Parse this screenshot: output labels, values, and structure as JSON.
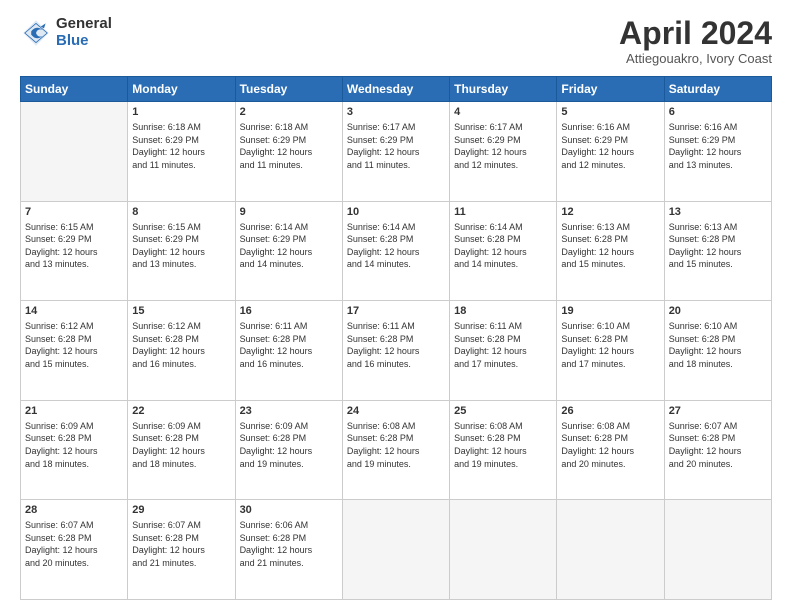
{
  "logo": {
    "general": "General",
    "blue": "Blue"
  },
  "header": {
    "month": "April 2024",
    "location": "Attiegouakro, Ivory Coast"
  },
  "weekdays": [
    "Sunday",
    "Monday",
    "Tuesday",
    "Wednesday",
    "Thursday",
    "Friday",
    "Saturday"
  ],
  "weeks": [
    [
      {
        "day": "",
        "info": ""
      },
      {
        "day": "1",
        "info": "Sunrise: 6:18 AM\nSunset: 6:29 PM\nDaylight: 12 hours\nand 11 minutes."
      },
      {
        "day": "2",
        "info": "Sunrise: 6:18 AM\nSunset: 6:29 PM\nDaylight: 12 hours\nand 11 minutes."
      },
      {
        "day": "3",
        "info": "Sunrise: 6:17 AM\nSunset: 6:29 PM\nDaylight: 12 hours\nand 11 minutes."
      },
      {
        "day": "4",
        "info": "Sunrise: 6:17 AM\nSunset: 6:29 PM\nDaylight: 12 hours\nand 12 minutes."
      },
      {
        "day": "5",
        "info": "Sunrise: 6:16 AM\nSunset: 6:29 PM\nDaylight: 12 hours\nand 12 minutes."
      },
      {
        "day": "6",
        "info": "Sunrise: 6:16 AM\nSunset: 6:29 PM\nDaylight: 12 hours\nand 13 minutes."
      }
    ],
    [
      {
        "day": "7",
        "info": "Sunrise: 6:15 AM\nSunset: 6:29 PM\nDaylight: 12 hours\nand 13 minutes."
      },
      {
        "day": "8",
        "info": "Sunrise: 6:15 AM\nSunset: 6:29 PM\nDaylight: 12 hours\nand 13 minutes."
      },
      {
        "day": "9",
        "info": "Sunrise: 6:14 AM\nSunset: 6:29 PM\nDaylight: 12 hours\nand 14 minutes."
      },
      {
        "day": "10",
        "info": "Sunrise: 6:14 AM\nSunset: 6:28 PM\nDaylight: 12 hours\nand 14 minutes."
      },
      {
        "day": "11",
        "info": "Sunrise: 6:14 AM\nSunset: 6:28 PM\nDaylight: 12 hours\nand 14 minutes."
      },
      {
        "day": "12",
        "info": "Sunrise: 6:13 AM\nSunset: 6:28 PM\nDaylight: 12 hours\nand 15 minutes."
      },
      {
        "day": "13",
        "info": "Sunrise: 6:13 AM\nSunset: 6:28 PM\nDaylight: 12 hours\nand 15 minutes."
      }
    ],
    [
      {
        "day": "14",
        "info": "Sunrise: 6:12 AM\nSunset: 6:28 PM\nDaylight: 12 hours\nand 15 minutes."
      },
      {
        "day": "15",
        "info": "Sunrise: 6:12 AM\nSunset: 6:28 PM\nDaylight: 12 hours\nand 16 minutes."
      },
      {
        "day": "16",
        "info": "Sunrise: 6:11 AM\nSunset: 6:28 PM\nDaylight: 12 hours\nand 16 minutes."
      },
      {
        "day": "17",
        "info": "Sunrise: 6:11 AM\nSunset: 6:28 PM\nDaylight: 12 hours\nand 16 minutes."
      },
      {
        "day": "18",
        "info": "Sunrise: 6:11 AM\nSunset: 6:28 PM\nDaylight: 12 hours\nand 17 minutes."
      },
      {
        "day": "19",
        "info": "Sunrise: 6:10 AM\nSunset: 6:28 PM\nDaylight: 12 hours\nand 17 minutes."
      },
      {
        "day": "20",
        "info": "Sunrise: 6:10 AM\nSunset: 6:28 PM\nDaylight: 12 hours\nand 18 minutes."
      }
    ],
    [
      {
        "day": "21",
        "info": "Sunrise: 6:09 AM\nSunset: 6:28 PM\nDaylight: 12 hours\nand 18 minutes."
      },
      {
        "day": "22",
        "info": "Sunrise: 6:09 AM\nSunset: 6:28 PM\nDaylight: 12 hours\nand 18 minutes."
      },
      {
        "day": "23",
        "info": "Sunrise: 6:09 AM\nSunset: 6:28 PM\nDaylight: 12 hours\nand 19 minutes."
      },
      {
        "day": "24",
        "info": "Sunrise: 6:08 AM\nSunset: 6:28 PM\nDaylight: 12 hours\nand 19 minutes."
      },
      {
        "day": "25",
        "info": "Sunrise: 6:08 AM\nSunset: 6:28 PM\nDaylight: 12 hours\nand 19 minutes."
      },
      {
        "day": "26",
        "info": "Sunrise: 6:08 AM\nSunset: 6:28 PM\nDaylight: 12 hours\nand 20 minutes."
      },
      {
        "day": "27",
        "info": "Sunrise: 6:07 AM\nSunset: 6:28 PM\nDaylight: 12 hours\nand 20 minutes."
      }
    ],
    [
      {
        "day": "28",
        "info": "Sunrise: 6:07 AM\nSunset: 6:28 PM\nDaylight: 12 hours\nand 20 minutes."
      },
      {
        "day": "29",
        "info": "Sunrise: 6:07 AM\nSunset: 6:28 PM\nDaylight: 12 hours\nand 21 minutes."
      },
      {
        "day": "30",
        "info": "Sunrise: 6:06 AM\nSunset: 6:28 PM\nDaylight: 12 hours\nand 21 minutes."
      },
      {
        "day": "",
        "info": ""
      },
      {
        "day": "",
        "info": ""
      },
      {
        "day": "",
        "info": ""
      },
      {
        "day": "",
        "info": ""
      }
    ]
  ]
}
